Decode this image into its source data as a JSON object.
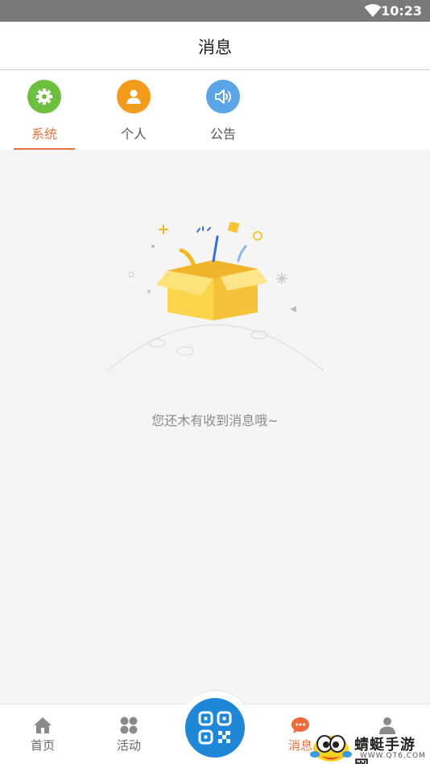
{
  "status_bar": {
    "time": "10:23"
  },
  "header": {
    "title": "消息"
  },
  "tabs": [
    {
      "label": "系统",
      "icon": "gear-icon",
      "color": "#6cbf3f",
      "active": true
    },
    {
      "label": "个人",
      "icon": "user-icon",
      "color": "#f39b1a",
      "active": false
    },
    {
      "label": "公告",
      "icon": "speaker-icon",
      "color": "#5aa4e8",
      "active": false
    }
  ],
  "empty_state": {
    "message": "您还木有收到消息哦~"
  },
  "bottom_nav": {
    "items": [
      {
        "label": "首页",
        "icon": "home-icon"
      },
      {
        "label": "活动",
        "icon": "grid-icon"
      },
      {
        "label": "消息",
        "icon": "chat-icon",
        "active": true
      },
      {
        "label": "",
        "icon": "profile-icon"
      }
    ],
    "center": {
      "icon": "qr-scan-icon"
    }
  },
  "watermark": {
    "text": "蜻蜓手游网",
    "url": "WWW.QT6.COM"
  },
  "colors": {
    "accent": "#e8733c",
    "scan_blue": "#1f87d7"
  }
}
